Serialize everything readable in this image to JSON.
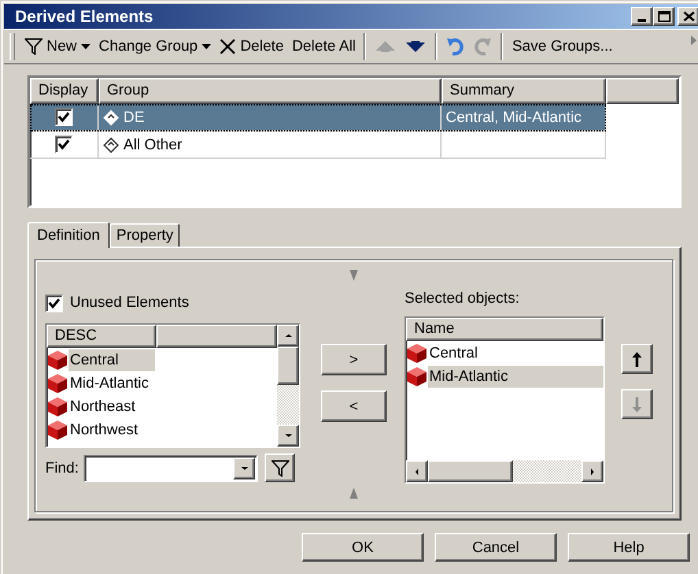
{
  "window": {
    "title": "Derived Elements"
  },
  "toolbar": [
    {
      "kind": "filter",
      "label": "New",
      "dropdown": true,
      "disabled": false
    },
    {
      "kind": "plain",
      "label": "Change Group",
      "dropdown": true,
      "disabled": false
    },
    {
      "kind": "delete",
      "label": "Delete",
      "dropdown": false,
      "disabled": false
    },
    {
      "kind": "plain",
      "label": "Delete All",
      "dropdown": false,
      "disabled": false
    },
    {
      "kind": "separator"
    },
    {
      "kind": "up",
      "dropdown": false,
      "disabled": true
    },
    {
      "kind": "down",
      "dropdown": false,
      "disabled": false
    },
    {
      "kind": "separator"
    },
    {
      "kind": "undo",
      "dropdown": false,
      "disabled": false
    },
    {
      "kind": "redo",
      "dropdown": false,
      "disabled": true
    },
    {
      "kind": "separator"
    },
    {
      "kind": "plain",
      "label": "Save Groups...",
      "dropdown": false,
      "disabled": false
    }
  ],
  "groups": {
    "columns": [
      "Display",
      "Group",
      "Summary"
    ],
    "rows": [
      {
        "checked": true,
        "group": "DE",
        "summary": "Central, Mid-Atlantic",
        "selected": true
      },
      {
        "checked": true,
        "group": "All Other",
        "selected": false
      }
    ]
  },
  "tabs": [
    {
      "label": "Definition",
      "selected": true
    },
    {
      "label": "Property",
      "selected": false
    }
  ],
  "unused_elements": {
    "label": "Unused Elements",
    "checked": true
  },
  "available_list": {
    "column": "DESC",
    "items": [
      {
        "label": "Central",
        "selected": true
      },
      {
        "label": "Mid-Atlantic",
        "selected": false
      },
      {
        "label": "Northeast",
        "selected": false
      },
      {
        "label": "Northwest",
        "selected": false
      }
    ]
  },
  "find": {
    "label": "Find:"
  },
  "move_buttons": [
    ">",
    "<"
  ],
  "selected_objects": {
    "label": "Selected objects:",
    "column": "Name",
    "items": [
      {
        "label": "Central",
        "selected": false
      },
      {
        "label": "Mid-Atlantic",
        "selected": true
      }
    ]
  },
  "order_buttons": [
    {
      "kind": "up",
      "disabled": false
    },
    {
      "kind": "down",
      "disabled": true
    }
  ],
  "buttons": [
    "OK",
    "Cancel",
    "Help"
  ]
}
